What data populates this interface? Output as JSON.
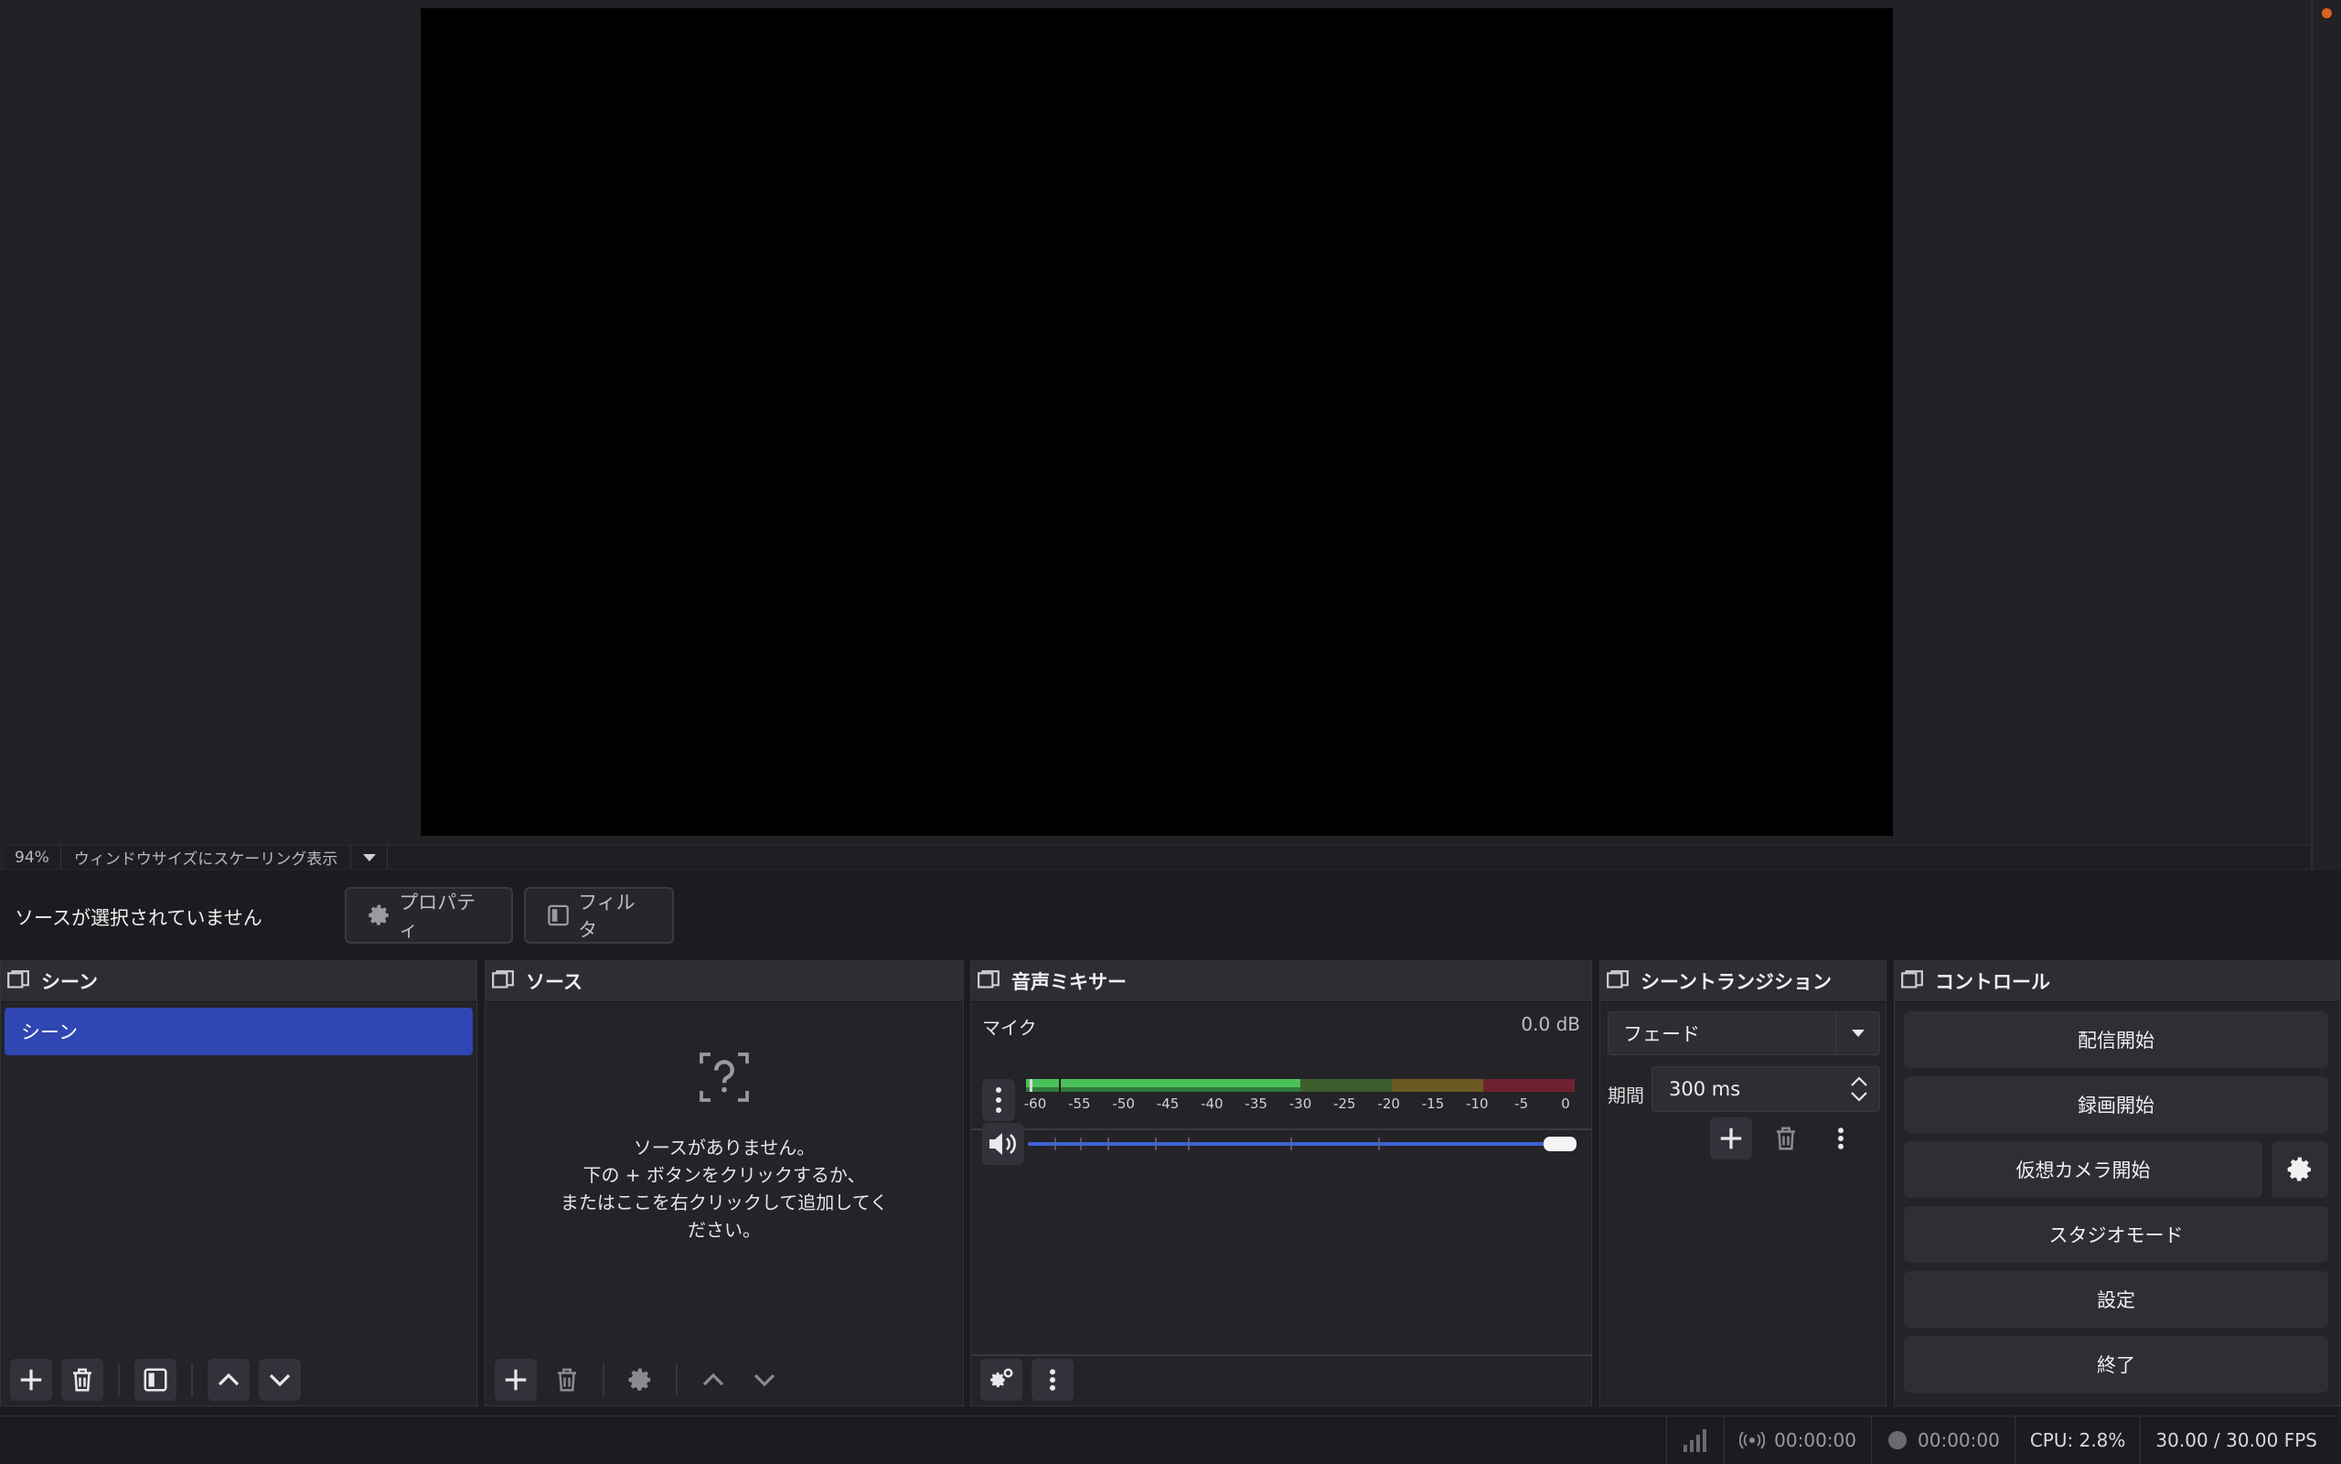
{
  "preview": {
    "zoom": "94%",
    "scale_mode": "ウィンドウサイズにスケーリング表示"
  },
  "context": {
    "no_source": "ソースが選択されていません",
    "properties_label": "プロパティ",
    "filters_label": "フィルタ"
  },
  "scenes": {
    "title": "シーン",
    "items": [
      "シーン"
    ]
  },
  "sources": {
    "title": "ソース",
    "empty_lines": [
      "ソースがありません。",
      "下の + ボタンをクリックするか、",
      "またはここを右クリックして追加してく",
      "ださい。"
    ]
  },
  "mixer": {
    "title": "音声ミキサー",
    "channel": {
      "name": "マイク",
      "level": "0.0 dB",
      "volume_fraction": 1.0
    },
    "scale": [
      "-60",
      "-55",
      "-50",
      "-45",
      "-40",
      "-35",
      "-30",
      "-25",
      "-20",
      "-15",
      "-10",
      "-5",
      "0"
    ]
  },
  "transitions": {
    "title": "シーントランジション",
    "selected": "フェード",
    "duration_label": "期間",
    "duration_value": "300 ms"
  },
  "controls": {
    "title": "コントロール",
    "start_streaming": "配信開始",
    "start_recording": "録画開始",
    "start_virtualcam": "仮想カメラ開始",
    "studio_mode": "スタジオモード",
    "settings": "設定",
    "exit": "終了"
  },
  "status": {
    "stream_time": "00:00:00",
    "rec_time": "00:00:00",
    "cpu": "CPU: 2.8%",
    "fps": "30.00 / 30.00 FPS"
  },
  "colors": {
    "accent": "#2f46b3",
    "meter_green": "#4cc159",
    "meter_yellow": "#b48a2c",
    "meter_red": "#b3253a",
    "slider_blue": "#3d63d6",
    "rec_indicator": "#d9641f"
  }
}
